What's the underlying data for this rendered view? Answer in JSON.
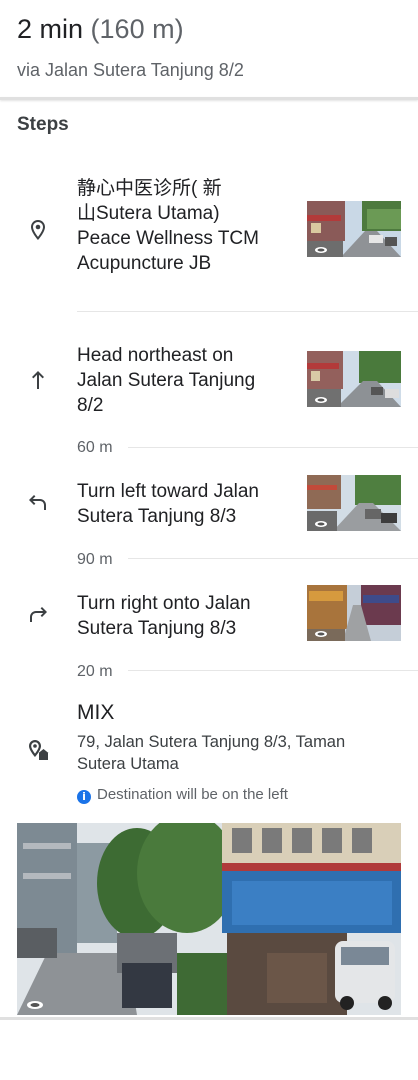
{
  "header": {
    "duration": "2 min",
    "distance": "(160 m)",
    "via": "via Jalan Sutera Tanjung 8/2"
  },
  "steps_title": "Steps",
  "steps": [
    {
      "icon": "location-pin-icon",
      "lines": [
        "静心中医诊所( 新",
        "山Sutera Utama)",
        "Peace Wellness TCM",
        "Acupuncture JB"
      ]
    },
    {
      "icon": "arrow-up-icon",
      "lines": [
        "Head northeast on",
        "Jalan Sutera Tanjung",
        "8/2"
      ],
      "distance": "60 m"
    },
    {
      "icon": "turn-left-icon",
      "lines": [
        "Turn left toward Jalan",
        "Sutera Tanjung 8/3"
      ],
      "distance": "90 m"
    },
    {
      "icon": "turn-right-icon",
      "lines": [
        "Turn right onto Jalan",
        "Sutera Tanjung 8/3"
      ],
      "distance": "20 m"
    }
  ],
  "destination": {
    "icon": "destination-pin-icon",
    "name": "MIX",
    "address": "79, Jalan Sutera Tanjung 8/3, Taman Sutera Utama",
    "note": "Destination will be on the left",
    "note_icon": "info-icon"
  },
  "colors": {
    "text_primary": "#202124",
    "text_secondary": "#5f6368",
    "info_blue": "#1a73e8",
    "divider": "#e0e0e0"
  }
}
